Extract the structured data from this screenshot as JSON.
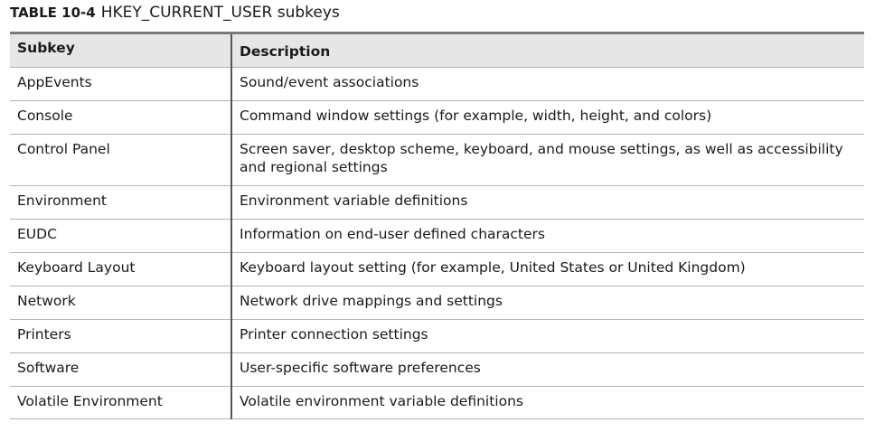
{
  "caption": {
    "label": "TABLE 10-4",
    "title": "HKEY_CURRENT_USER subkeys"
  },
  "table": {
    "headers": [
      "Subkey",
      "Description"
    ],
    "rows": [
      {
        "subkey": "AppEvents",
        "description": "Sound/event associations"
      },
      {
        "subkey": "Console",
        "description": "Command window settings (for example, width, height, and colors)"
      },
      {
        "subkey": "Control Panel",
        "description": "Screen saver, desktop scheme, keyboard, and mouse settings, as well as accessibility and regional settings"
      },
      {
        "subkey": "Environment",
        "description": "Environment variable definitions"
      },
      {
        "subkey": "EUDC",
        "description": "Information on end-user defined characters"
      },
      {
        "subkey": "Keyboard Layout",
        "description": "Keyboard layout setting (for example, United States or United Kingdom)"
      },
      {
        "subkey": "Network",
        "description": "Network drive mappings and settings"
      },
      {
        "subkey": "Printers",
        "description": "Printer connection settings"
      },
      {
        "subkey": "Software",
        "description": "User-specific software preferences"
      },
      {
        "subkey": "Volatile Environment",
        "description": "Volatile environment variable definitions"
      }
    ]
  }
}
